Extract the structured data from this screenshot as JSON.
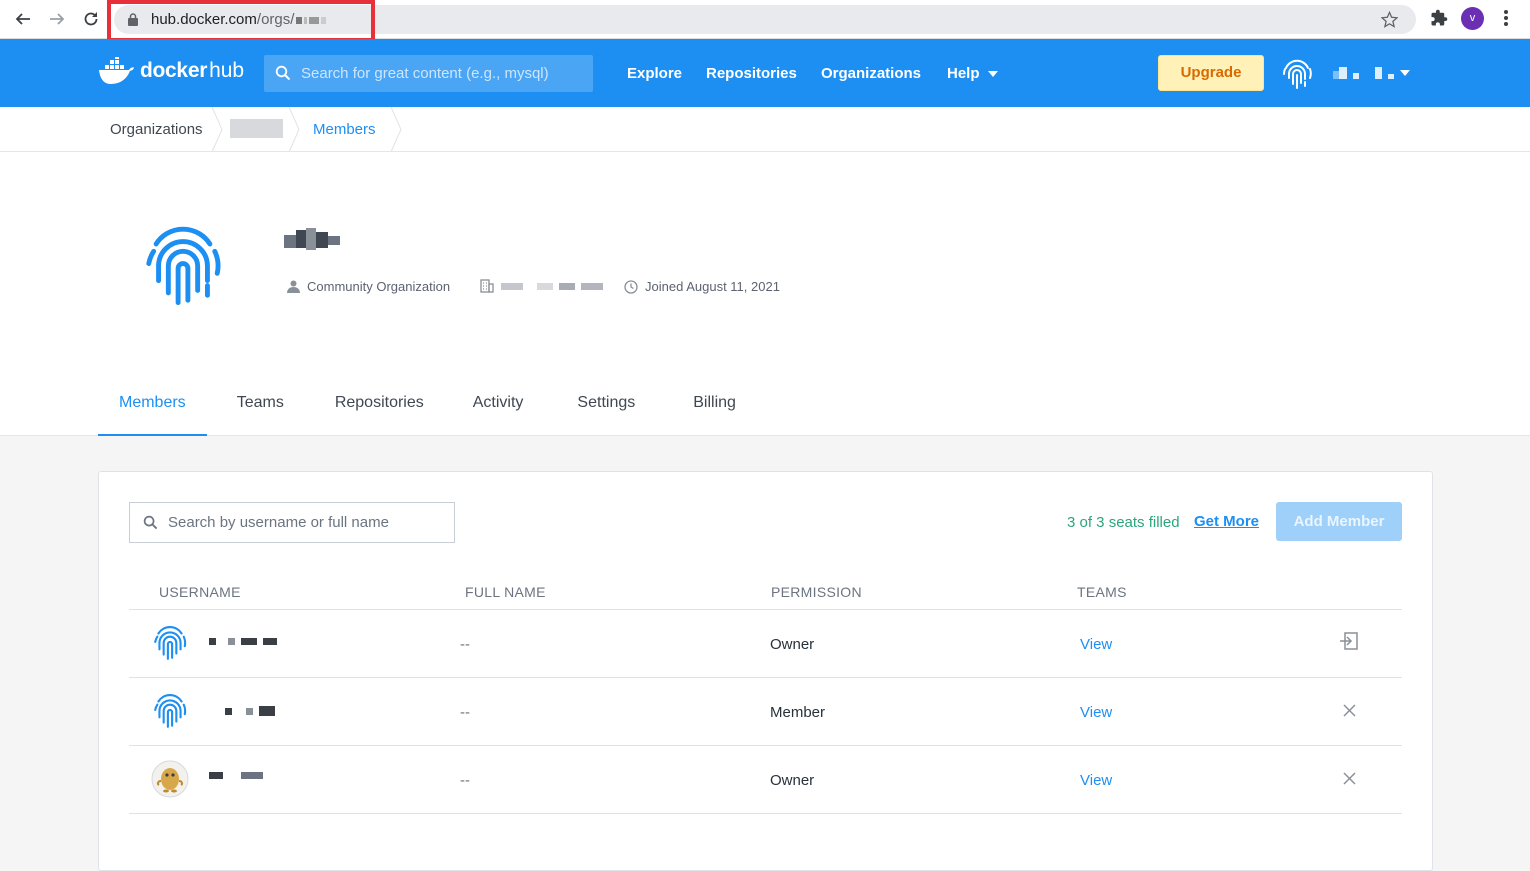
{
  "browser": {
    "url_host": "hub.docker.com",
    "url_path": "/orgs/",
    "profile_initial": "v"
  },
  "header": {
    "logo_docker": "docker",
    "logo_hub": "hub",
    "search_placeholder": "Search for great content (e.g., mysql)",
    "nav": [
      "Explore",
      "Repositories",
      "Organizations",
      "Help"
    ],
    "upgrade_label": "Upgrade",
    "accent_color": "#1d8ff2"
  },
  "breadcrumb": {
    "root": "Organizations",
    "current": "Members"
  },
  "org": {
    "type": "Community Organization",
    "joined": "Joined August 11, 2021"
  },
  "tabs": [
    "Members",
    "Teams",
    "Repositories",
    "Activity",
    "Settings",
    "Billing"
  ],
  "members": {
    "search_placeholder": "Search by username or full name",
    "seats_text": "3 of 3 seats filled",
    "get_more_label": "Get More",
    "add_member_label": "Add Member",
    "columns": [
      "USERNAME",
      "FULL NAME",
      "PERMISSION",
      "TEAMS"
    ],
    "rows": [
      {
        "full_name": "--",
        "permission": "Owner",
        "teams": "View",
        "action_icon": "leave-icon",
        "avatar": "fingerprint-icon"
      },
      {
        "full_name": "--",
        "permission": "Member",
        "teams": "View",
        "action_icon": "close-icon",
        "avatar": "fingerprint-icon"
      },
      {
        "full_name": "--",
        "permission": "Owner",
        "teams": "View",
        "action_icon": "close-icon",
        "avatar": "potato-avatar"
      }
    ]
  }
}
